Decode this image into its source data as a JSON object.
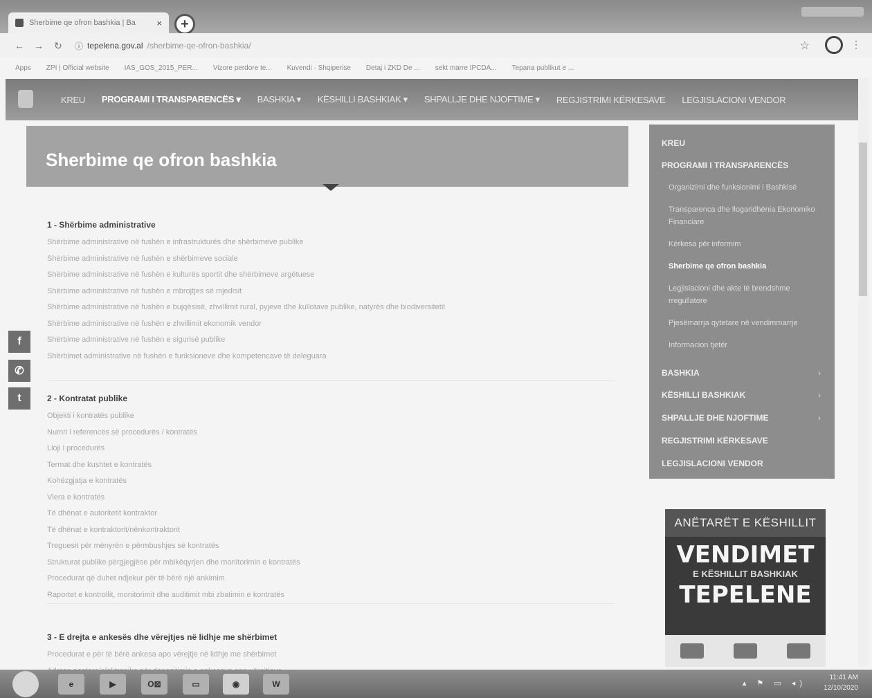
{
  "browser": {
    "tab_title": "Sherbime qe ofron bashkia | Ba",
    "tab_close": "×",
    "new_tab": "+",
    "url_host": "tepelena.gov.al",
    "url_path": "/sherbime-qe-ofron-bashkia/",
    "bookmarks": [
      "Apps",
      "ZPI | Official website",
      "IAS_GOS_2015_PER...",
      "Vizore perdore te...",
      "Kuvendi · Shqiperise",
      "Detaj i ZKD De ...",
      "sekt marre IPCDA...",
      "Tepana publikut e ..."
    ]
  },
  "site_nav": {
    "items": [
      "KREU",
      "PROGRAMI I TRANSPARENCËS ▾",
      "BASHKIA ▾",
      "KËSHILLI BASHKIAK ▾",
      "SHPALLJE DHE NJOFTIME ▾",
      "REGJISTRIMI KËRKESAVE",
      "LEGJISLACIONI VENDOR"
    ]
  },
  "page": {
    "title": "Sherbime qe ofron bashkia"
  },
  "sections": [
    {
      "title": "1 - Shërbime administrative",
      "items": [
        "Shërbime administrative në fushën e infrastrukturës dhe shërbimeve publike",
        "Shërbime administrative në fushën e shërbimeve sociale",
        "Shërbime administrative në fushën e kulturës sportit dhe shërbimeve argëtuese",
        "Shërbime administrative në fushën e mbrojtjes së mjedisit",
        "Shërbime administrative në fushën e bujqësisë, zhvillimit rural, pyjeve dhe kullotave publike, natyrës dhe biodiversitetit",
        "Shërbime administrative në fushën e zhvillimit ekonomik vendor",
        "Shërbime administrative në fushën e sigurisë publike",
        "Shërbimet administrative në fushën e funksioneve dhe kompetencave të deleguara"
      ]
    },
    {
      "title": "2 - Kontratat publike",
      "items": [
        "Objekti i kontratës publike",
        "Numri i referencës së procedurës / kontratës",
        "Lloji i procedurës",
        "Termat dhe kushtet e kontratës",
        "Kohëzgjatja e kontratës",
        "Vlera e kontratës",
        "Të dhënat e autoritetit kontraktor",
        "Të dhënat e kontraktorit/nënkontraktorit",
        "Treguesit për mënyrën e përmbushjes së kontratës",
        "Strukturat publike përgjegjëse për mbikëqyrjen dhe monitorimin e kontratës",
        "Procedurat që duhet ndjekur për të bërë një ankimim",
        "Raportet e kontrollit, monitorimit dhe auditimit mbi zbatimin e kontratës"
      ]
    },
    {
      "title": "3 - E drejta e ankesës dhe vërejtjes në lidhje me shërbimet",
      "items": [
        "Procedurat e për të bërë ankesa apo vërejtje në lidhje me shërbimet",
        "Adresa postare/elektronike për depozitimin e ankesave apo vërejtjeve"
      ]
    }
  ],
  "share": {
    "facebook": "f",
    "whatsapp": "✆",
    "twitter": "t"
  },
  "sidebar": {
    "kreu": "KREU",
    "programi": "PROGRAMI I TRANSPARENCËS",
    "sub": [
      "Organizimi dhe funksionimi i Bashkisë",
      "Transparenca dhe llogaridhënia Ekonomiko Financiare",
      "Kërkesa për informim",
      "Sherbime qe ofron bashkia",
      "Legjislacioni dhe akte të brendshme rregullatore",
      "Pjesëmarrja qytetare në vendimmarrje",
      "Informacion tjetër"
    ],
    "bashkia": "BASHKIA",
    "keshilli": "KËSHILLI BASHKIAK",
    "shpallje": "SHPALLJE DHE NJOFTIME",
    "regjistrimi": "REGJISTRIMI KËRKESAVE",
    "legjislacioni": "LEGJISLACIONI VENDOR",
    "chevron": "›"
  },
  "ad": {
    "head": "ANËTARËT E KËSHILLIT",
    "big1": "VENDIMET",
    "mid": "E KËSHILLIT BASHKIAK",
    "big2": "TEPELENE"
  },
  "taskbar": {
    "time": "11:41 AM",
    "date": "12/10/2020",
    "app_outlook": "O⊠",
    "app_word": "W"
  }
}
